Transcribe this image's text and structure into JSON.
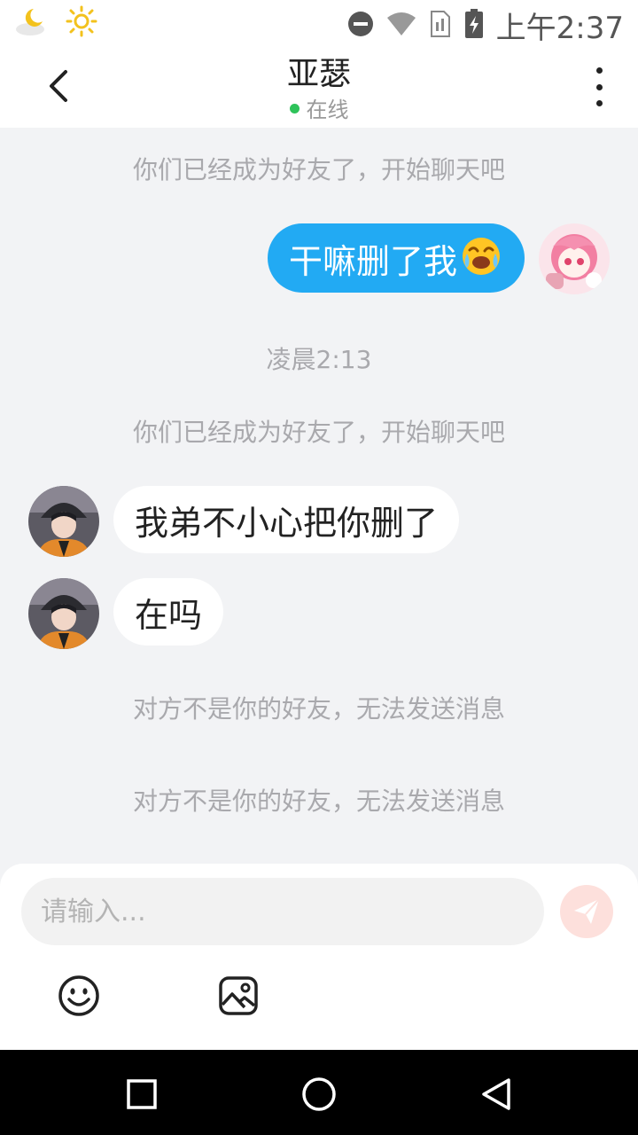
{
  "status_bar": {
    "time": "上午2:37",
    "icons": [
      "night-weather-icon",
      "sun-icon",
      "do-not-disturb-icon",
      "wifi-icon",
      "sim-icon",
      "battery-charging-icon"
    ]
  },
  "header": {
    "title": "亚瑟",
    "status": "在线",
    "status_color": "#2ec35a"
  },
  "chat": {
    "system_1": "你们已经成为好友了，开始聊天吧",
    "outgoing_1": "干嘛删了我",
    "outgoing_1_emoji": "crying-emoji-icon",
    "timestamp_1": "凌晨2:13",
    "system_2": "你们已经成为好友了，开始聊天吧",
    "incoming_1": "我弟不小心把你删了",
    "incoming_2": "在吗",
    "system_3": "对方不是你的好友，无法发送消息",
    "system_4": "对方不是你的好友，无法发送消息"
  },
  "composer": {
    "placeholder": "请输入...",
    "send_icon": "send-icon",
    "tools": [
      "emoji-icon",
      "image-icon"
    ]
  },
  "colors": {
    "accent": "#22aaf3",
    "background": "#f2f3f5",
    "send_disabled": "#fde0dc"
  },
  "nav": [
    "recents-icon",
    "home-icon",
    "back-icon"
  ]
}
